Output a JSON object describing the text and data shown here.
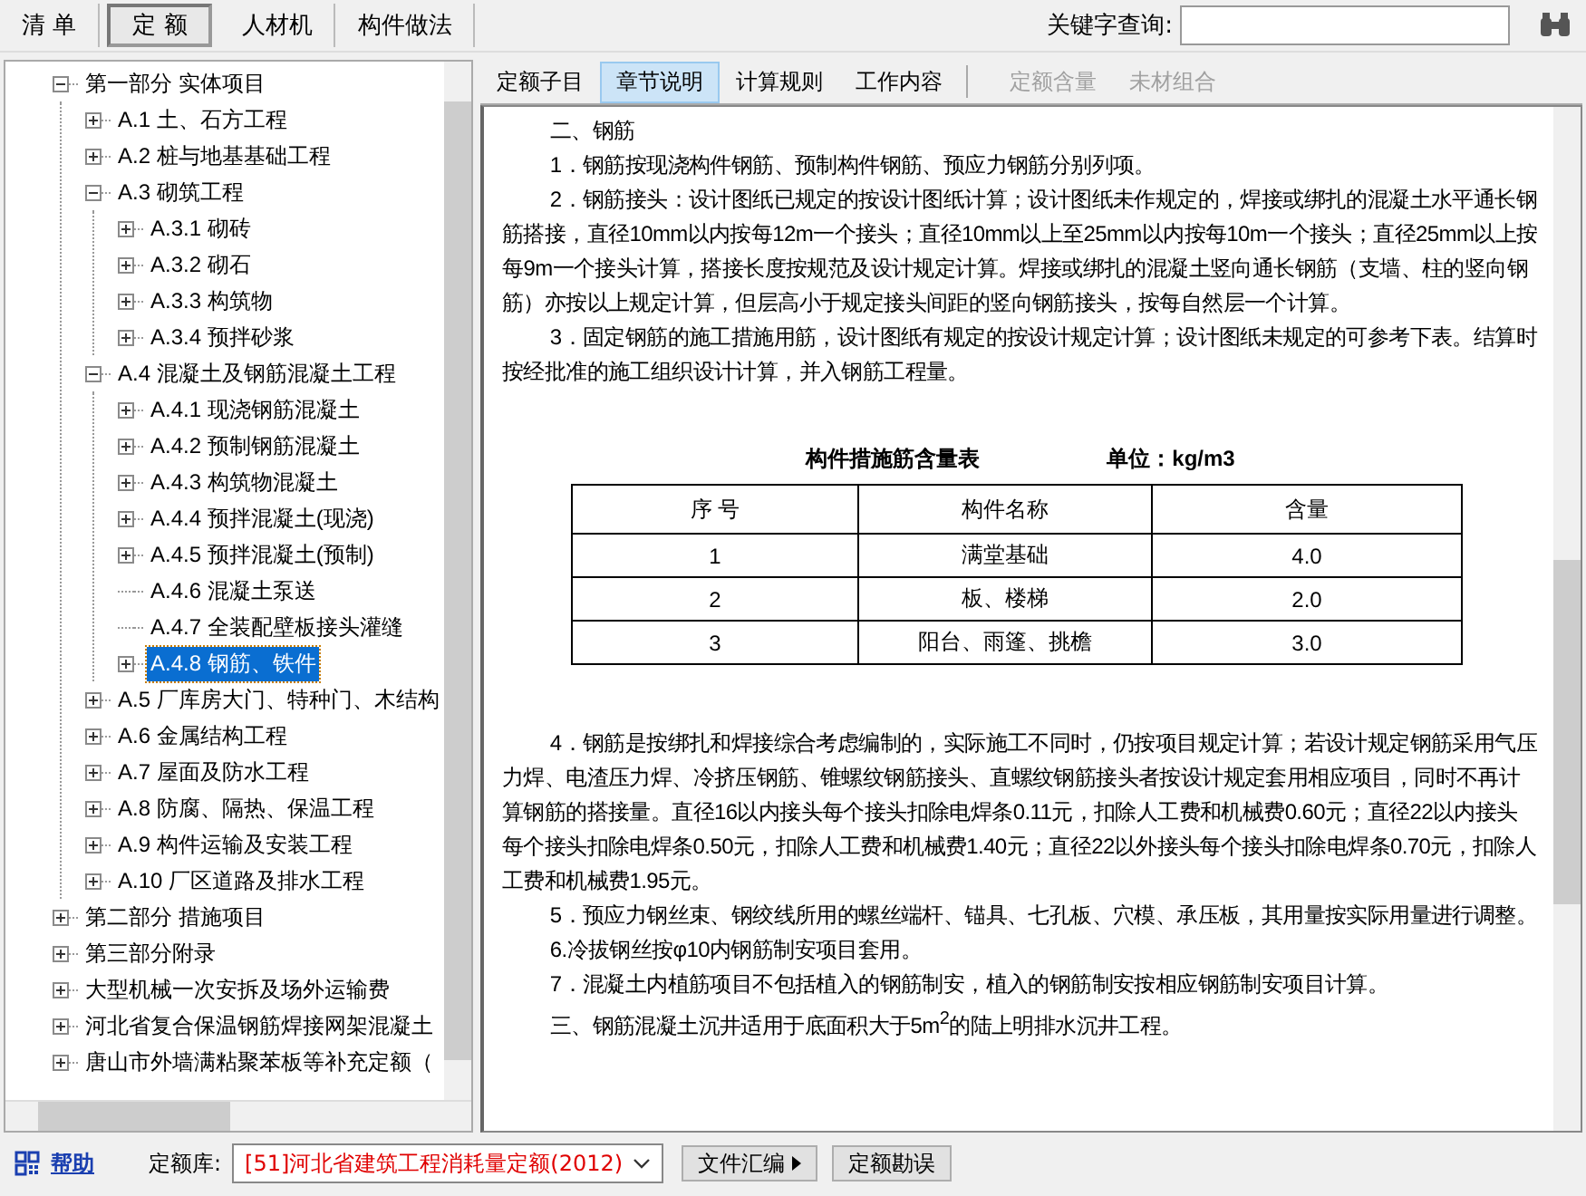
{
  "toolbar": {
    "tabs": [
      {
        "label": "清 单",
        "selected": false
      },
      {
        "label": "定 额",
        "selected": true
      },
      {
        "label": "人材机",
        "selected": false
      },
      {
        "label": "构件做法",
        "selected": false
      }
    ],
    "search": {
      "label": "关键字查询:"
    }
  },
  "tree": {
    "items": [
      {
        "label": "第一部分 实体项目",
        "kind": "branch",
        "expanded": true,
        "selected": false,
        "children": [
          {
            "label": "A.1 土、石方工程",
            "kind": "branch",
            "expanded": false,
            "selected": false
          },
          {
            "label": "A.2 桩与地基基础工程",
            "kind": "branch",
            "expanded": false,
            "selected": false
          },
          {
            "label": "A.3 砌筑工程",
            "kind": "branch",
            "expanded": true,
            "selected": false,
            "children": [
              {
                "label": "A.3.1 砌砖",
                "kind": "branch",
                "expanded": false,
                "selected": false
              },
              {
                "label": "A.3.2 砌石",
                "kind": "branch",
                "expanded": false,
                "selected": false
              },
              {
                "label": "A.3.3 构筑物",
                "kind": "branch",
                "expanded": false,
                "selected": false
              },
              {
                "label": "A.3.4 预拌砂浆",
                "kind": "branch",
                "expanded": false,
                "selected": false
              }
            ]
          },
          {
            "label": "A.4 混凝土及钢筋混凝土工程",
            "kind": "branch",
            "expanded": true,
            "selected": false,
            "children": [
              {
                "label": "A.4.1 现浇钢筋混凝土",
                "kind": "branch",
                "expanded": false,
                "selected": false
              },
              {
                "label": "A.4.2 预制钢筋混凝土",
                "kind": "branch",
                "expanded": false,
                "selected": false
              },
              {
                "label": "A.4.3 构筑物混凝土",
                "kind": "branch",
                "expanded": false,
                "selected": false
              },
              {
                "label": "A.4.4 预拌混凝土(现浇)",
                "kind": "branch",
                "expanded": false,
                "selected": false
              },
              {
                "label": "A.4.5 预拌混凝土(预制)",
                "kind": "branch",
                "expanded": false,
                "selected": false
              },
              {
                "label": "A.4.6 混凝土泵送",
                "kind": "leaf",
                "selected": false
              },
              {
                "label": "A.4.7 全装配壁板接头灌缝",
                "kind": "leaf",
                "selected": false
              },
              {
                "label": "A.4.8 钢筋、铁件",
                "kind": "branch",
                "expanded": false,
                "selected": true
              }
            ]
          },
          {
            "label": "A.5 厂库房大门、特种门、木结构",
            "kind": "branch",
            "expanded": false,
            "selected": false
          },
          {
            "label": "A.6 金属结构工程",
            "kind": "branch",
            "expanded": false,
            "selected": false
          },
          {
            "label": "A.7 屋面及防水工程",
            "kind": "branch",
            "expanded": false,
            "selected": false
          },
          {
            "label": "A.8 防腐、隔热、保温工程",
            "kind": "branch",
            "expanded": false,
            "selected": false
          },
          {
            "label": "A.9 构件运输及安装工程",
            "kind": "branch",
            "expanded": false,
            "selected": false
          },
          {
            "label": "A.10 厂区道路及排水工程",
            "kind": "branch",
            "expanded": false,
            "selected": false
          }
        ]
      },
      {
        "label": "第二部分 措施项目",
        "kind": "branch",
        "expanded": false,
        "selected": false
      },
      {
        "label": "第三部分附录",
        "kind": "branch",
        "expanded": false,
        "selected": false
      },
      {
        "label": "大型机械一次安拆及场外运输费",
        "kind": "branch",
        "expanded": false,
        "selected": false
      },
      {
        "label": "河北省复合保温钢筋焊接网架混凝土",
        "kind": "branch",
        "expanded": false,
        "selected": false
      },
      {
        "label": "唐山市外墙满粘聚苯板等补充定额（",
        "kind": "branch",
        "expanded": false,
        "selected": false
      }
    ]
  },
  "content_tabs": [
    {
      "label": "定额子目",
      "selected": false,
      "disabled": false
    },
    {
      "label": "章节说明",
      "selected": true,
      "disabled": false
    },
    {
      "label": "计算规则",
      "selected": false,
      "disabled": false
    },
    {
      "label": "工作内容",
      "selected": false,
      "disabled": false
    },
    {
      "label": "定额含量",
      "selected": false,
      "disabled": true
    },
    {
      "label": "未材组合",
      "selected": false,
      "disabled": true
    }
  ],
  "document": {
    "paragraphs_before": [
      "二、钢筋",
      "1．钢筋按现浇构件钢筋、预制构件钢筋、预应力钢筋分别列项。",
      "2．钢筋接头：设计图纸已规定的按设计图纸计算；设计图纸未作规定的，焊接或绑扎的混凝土水平通长钢筋搭接，直径10mm以内按每12m一个接头；直径10mm以上至25mm以内按每10m一个接头；直径25mm以上按每9m一个接头计算，搭接长度按规范及设计规定计算。焊接或绑扎的混凝土竖向通长钢筋（支墙、柱的竖向钢筋）亦按以上规定计算，但层高小于规定接头间距的竖向钢筋接头，按每自然层一个计算。",
      "3．固定钢筋的施工措施用筋，设计图纸有规定的按设计规定计算；设计图纸未规定的可参考下表。结算时按经批准的施工组织设计计算，并入钢筋工程量。"
    ],
    "table": {
      "title": "构件措施筋含量表",
      "unit": "单位：kg/m3",
      "columns": [
        "序 号",
        "构件名称",
        "含量"
      ],
      "rows": [
        [
          "1",
          "满堂基础",
          "4.0"
        ],
        [
          "2",
          "板、楼梯",
          "2.0"
        ],
        [
          "3",
          "阳台、雨篷、挑檐",
          "3.0"
        ]
      ]
    },
    "paragraphs_after": [
      "4．钢筋是按绑扎和焊接综合考虑编制的，实际施工不同时，仍按项目规定计算；若设计规定钢筋采用气压力焊、电渣压力焊、冷挤压钢筋、锥螺纹钢筋接头、直螺纹钢筋接头者按设计规定套用相应项目，同时不再计算钢筋的搭接量。直径16以内接头每个接头扣除电焊条0.11元，扣除人工费和机械费0.60元；直径22以内接头每个接头扣除电焊条0.50元，扣除人工费和机械费1.40元；直径22以外接头每个接头扣除电焊条0.70元，扣除人工费和机械费1.95元。",
      "5．预应力钢丝束、钢绞线所用的螺丝端杆、锚具、七孔板、穴模、承压板，其用量按实际用量进行调整。",
      "6.冷拔钢丝按φ10内钢筋制安项目套用。",
      "7．混凝土内植筋项目不包括植入的钢筋制安，植入的钢筋制安按相应钢筋制安项目计算。",
      "三、钢筋混凝土沉井适用于底面积大于5m$^{2}$的陆上明排水沉井工程。"
    ]
  },
  "footer": {
    "help": "帮助",
    "library_label": "定额库:",
    "library_value": "[51]河北省建筑工程消耗量定额(2012)",
    "buttons": [
      {
        "label": "文件汇编",
        "kind": "menu"
      },
      {
        "label": "定额勘误",
        "kind": "plain"
      }
    ]
  }
}
